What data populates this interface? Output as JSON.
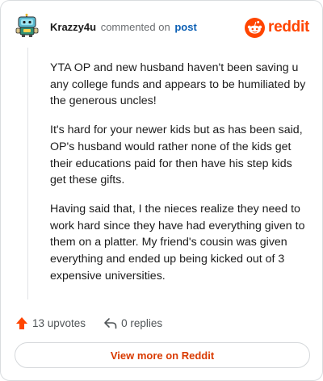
{
  "comment": {
    "author": "Krazzy4u",
    "action_text": "commented on",
    "post_link": "post",
    "paragraphs": [
      "YTA OP and new husband haven't been saving u any college funds and appears to be humiliated by the generous uncles!",
      "It's hard for your newer kids but as has been said, OP's husband would rather none of the kids get their educations paid for then have his step kids get these gifts.",
      "Having said that, I the nieces realize they need to work hard since they have had everything given to them on a platter. My friend's cousin was given everything and ended up being kicked out of 3 expensive universities."
    ]
  },
  "brand": {
    "wordmark": "reddit",
    "icon": "reddit-snoo-icon",
    "color": "#ff4500"
  },
  "actions": {
    "upvotes_label": "13 upvotes",
    "replies_label": "0 replies",
    "upvote_icon": "upvote-arrow-icon",
    "reply_icon": "reply-arrow-icon",
    "upvote_color": "#ff4500"
  },
  "footer": {
    "view_more_label": "View more on Reddit",
    "button_text_color": "#d93a00"
  }
}
